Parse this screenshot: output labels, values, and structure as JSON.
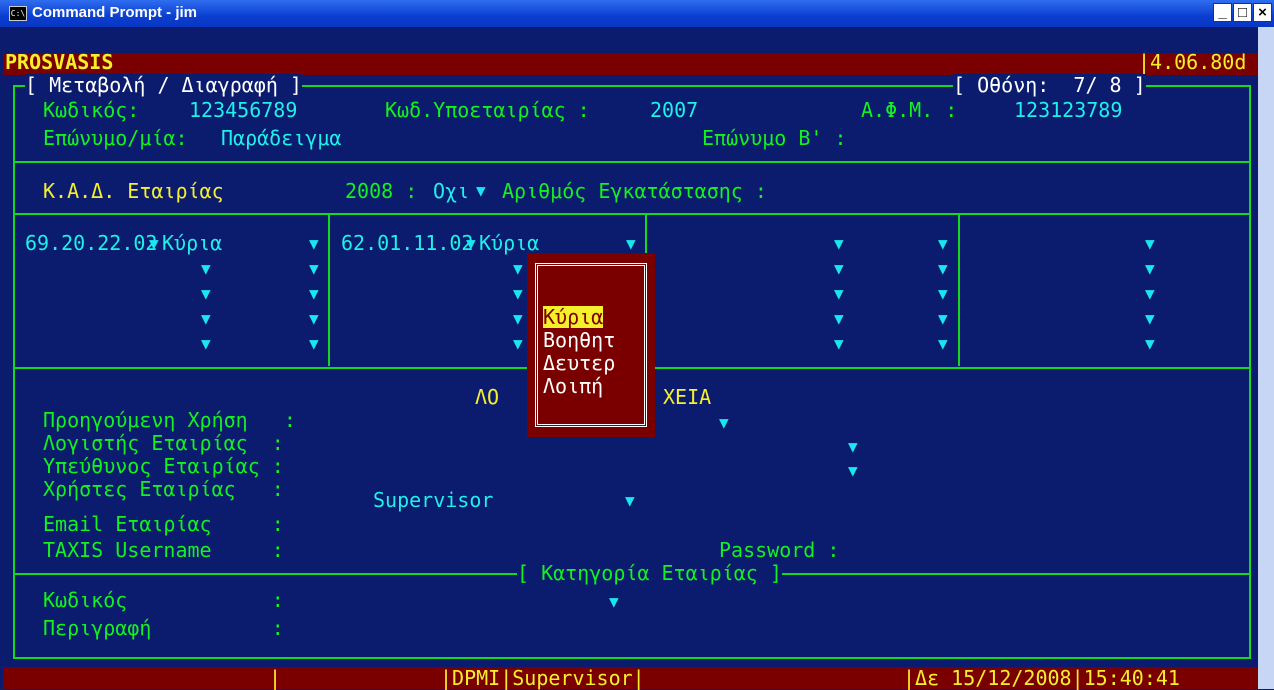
{
  "window": {
    "title": "Command Prompt - jim",
    "icon": "console-icon"
  },
  "header": {
    "app": "PROSVASIS",
    "version": "|4.06.80d"
  },
  "form": {
    "frame_title": "[ Μεταβολή / Διαγραφή ]",
    "screen": "[ Οθόνη:  7/ 8 ]",
    "code_label": "Κωδικός:",
    "code_value": "123456789",
    "subcompany_label": "Κωδ.Υποεταιρίας :",
    "subcompany_value": "2007",
    "afm_label": "Α.Φ.Μ. :",
    "afm_value": "123123789",
    "surname_label": "Επώνυμο/μία:",
    "surname_value": "Παράδειγμα",
    "surname_b_label": "Επώνυμο Β' :",
    "kad_label": "Κ.Α.Δ. Εταιρίας",
    "kad_year": "2008 :",
    "kad_flag": "Οχι",
    "establishment_label": "Αριθμός Εγκατάστασης :"
  },
  "kad_grid": {
    "cell1_code": "69.20.22.02",
    "cell1_type": "Κύρια",
    "cell2_code": "62.01.11.02",
    "cell2_type": "Κύρια"
  },
  "popup": {
    "items": [
      "Κύρια",
      "Βοηθητ",
      "Δευτερ",
      "Λοιπή"
    ],
    "selected": "Κύρια"
  },
  "other": {
    "section_left": "ΛΟ",
    "section_right": "ΧΕΙΑ",
    "prev_use_label": "Προηγούμενη Χρήση   :",
    "accountant_label": "Λογιστής Εταιρίας  :",
    "responsible_label": "Υπεύθυνος Εταιρίας :",
    "users_label": "Χρήστες Εταιρίας   :",
    "users_value": "Supervisor",
    "email_label": "Email Εταιρίας     :",
    "taxis_label": "TAXIS Username     :",
    "password_label": "Password :"
  },
  "category": {
    "title": "[ Κατηγορία Εταιρίας ]",
    "code_label": "Κωδικός            :",
    "desc_label": "Περιγραφή          :"
  },
  "statusbar": {
    "sep1": "|",
    "mode": "|DPMI|Supervisor|",
    "datetime": "|Δε 15/12/2008|15:40:41"
  },
  "colors": {
    "background": "#0b1b6e",
    "bar": "#7a0000",
    "text": "#14f020",
    "value": "#1ff0e8",
    "highlight": "#f6ef2c"
  }
}
